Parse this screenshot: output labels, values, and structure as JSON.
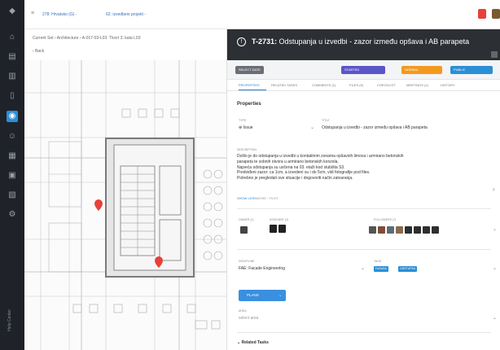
{
  "topbar": {
    "crumb1": "278: Hrvatsko (G) -",
    "crumb2": "62: izvedbeni projekt -"
  },
  "left": {
    "path": "Current Set › Architecture › A-017-03-L03: Tlocrt 3. kata L03",
    "back": "Back"
  },
  "rail": {
    "label": "Help Center"
  },
  "task": {
    "id": "T-2731:",
    "title": "Odstupanja u izvedbi - zazor između opšava i AB parapeta"
  },
  "toolbar": {
    "select": "SELECT DATE",
    "status": "STARTED",
    "priority": "NORMAL",
    "visibility": "PUBLIC"
  },
  "tabs": [
    "PROPERTIES",
    "RELATED TASKS",
    "COMMENTS (1)",
    "FILES (9)",
    "CHECKLIST",
    "MEETINGS (1)",
    "HISTORY"
  ],
  "properties": {
    "section": "Properties",
    "type_label": "TYPE",
    "type_value": "Issue",
    "title_label": "TITLE",
    "title_value": "Odstupanja u izvedbi - zazor između opšava i AB parapeta",
    "desc_label": "DESCRIPTION",
    "description": [
      "Došlo je do odstupanja u izvedbi u kontaktnim zonama opšavnih limova i armirano betonskih",
      "parapeta te sobnih otvora u armirano betonskih konzola.",
      "Najveća odstupanja su uočena na 03. etaži kod stubišta S3.",
      "Predviđeni zazor: ca 1cm, a izvedeni su i do 5cm, vidi fotografije pod files.",
      "Potrebno je pregledati ove situacije i dogovoriti način zatvaranja."
    ],
    "less": "SHOW LESS",
    "more": "MORE · FILES",
    "owner_label": "OWNER (1)",
    "assignee_label": "ASSIGNEE (2)",
    "followers_label": "FOLLOWERS (7)",
    "discipline_label": "DISCIPLINE",
    "discipline_value": "FAE: Facade Engineering",
    "tags_label": "TAGS",
    "tag1": "FASADA",
    "tag2": "ODSTUPKA",
    "plans_label": "PLANS",
    "area_label": "AREA",
    "area_value": "select area",
    "related": "Related Tasks"
  },
  "colors": {
    "accent": "#2b8fd6",
    "status": "#5b56c8",
    "priority": "#f39a1e",
    "header": "#2c2f33",
    "rail": "#1f2329",
    "pin": "#e8403a"
  }
}
